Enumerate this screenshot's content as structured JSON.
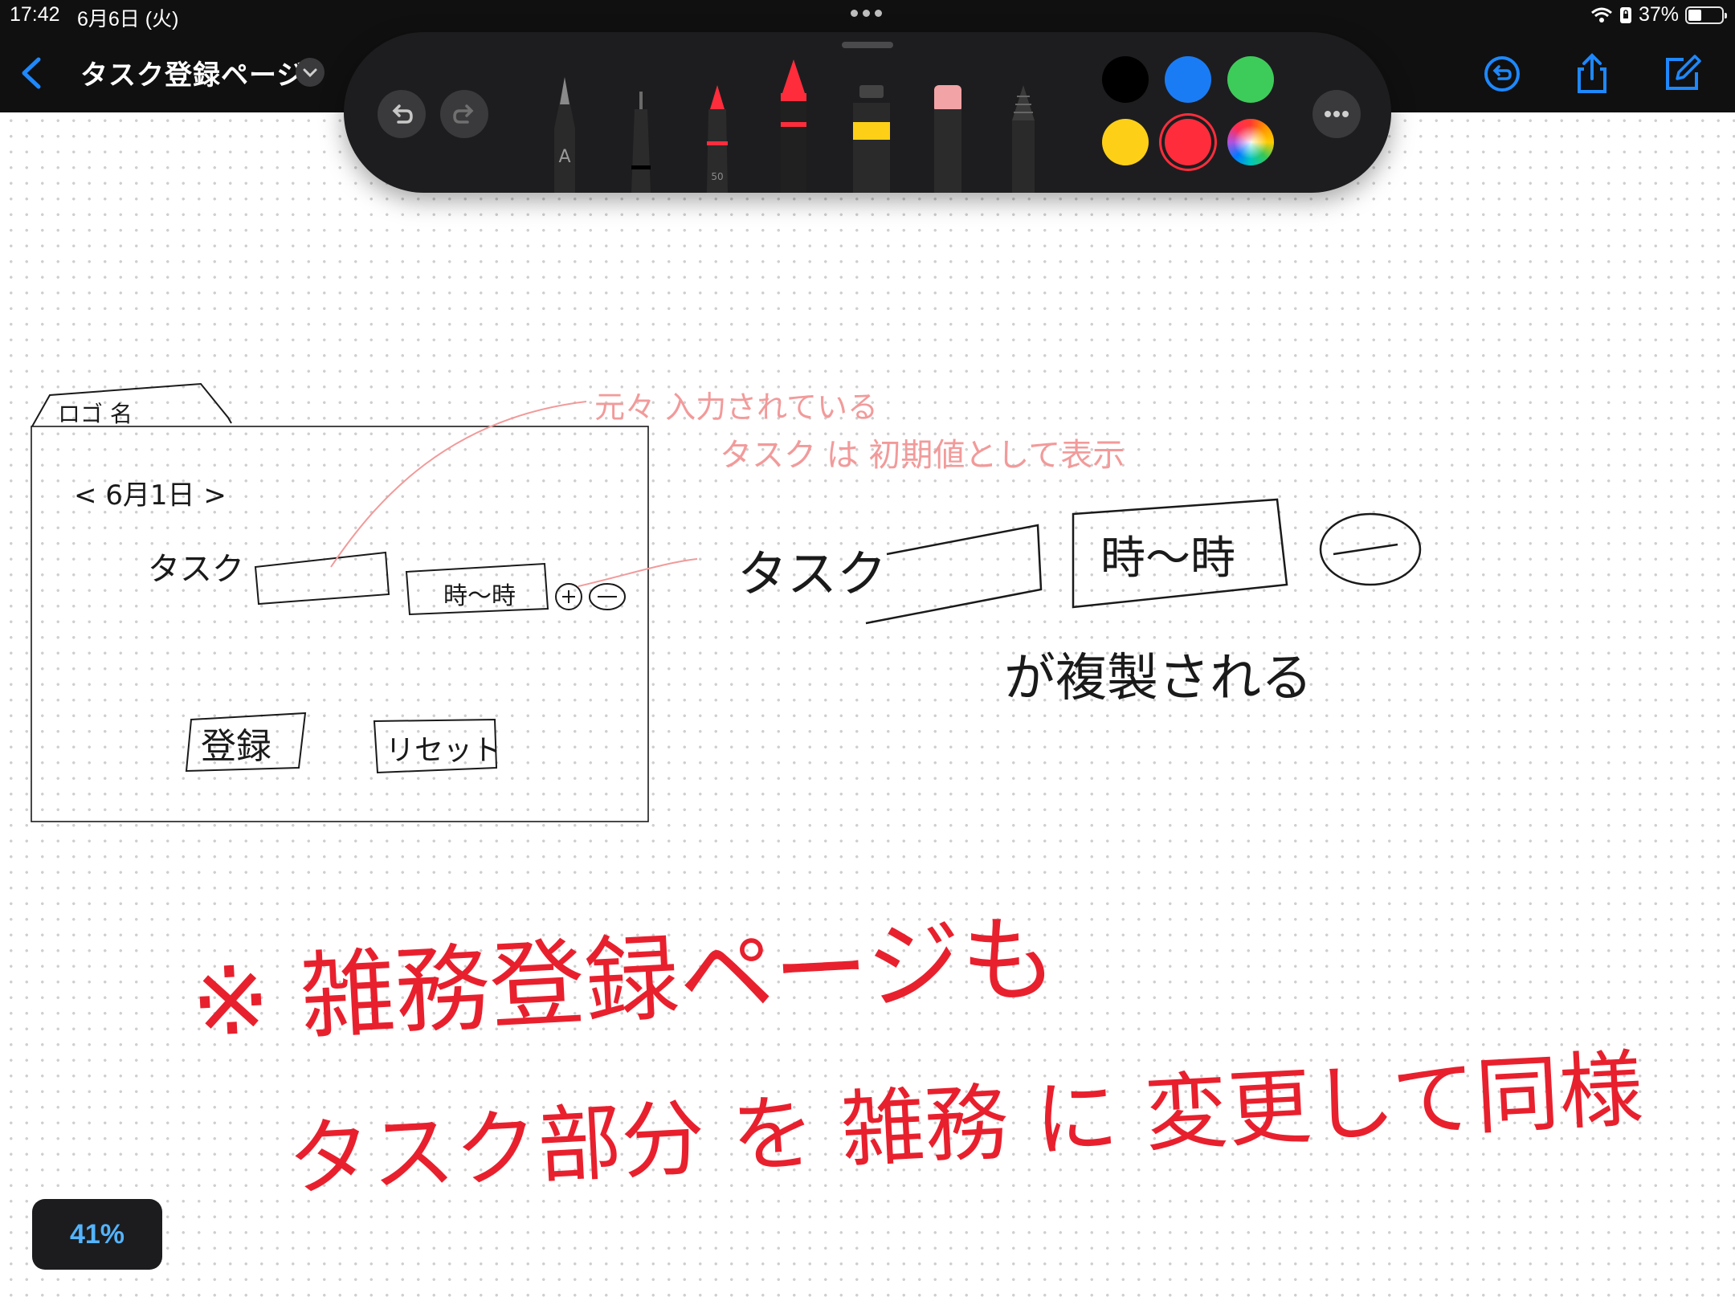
{
  "status_bar": {
    "time": "17:42",
    "date": "6月6日 (火)",
    "battery": "37%",
    "battery_level": 0.37
  },
  "nav": {
    "title": "タスク登録ページ"
  },
  "palette": {
    "pen_label": "A",
    "marker_size": "50",
    "colors": [
      "#000000",
      "#1a7cf5",
      "#3dcc5a",
      "#fdd017",
      "#ff2d3c"
    ],
    "selected_color": "#ff2d3c"
  },
  "zoom": {
    "level": "41%"
  },
  "drawing": {
    "stroke_colors": {
      "pencil": "#1a1a1a",
      "pink": "#f29a9a",
      "red": "#e8202d"
    },
    "logo_label": "ロゴ 名",
    "date_label": "< 6月1日 >",
    "task_label": "タスク",
    "time_label": "時〜時",
    "plus_minus": "⊕⊖",
    "register_button": "登録",
    "reset_button": "リセット",
    "note_pink_1": "元々 入力されている",
    "note_pink_2": "タスク は 初期値として表示",
    "big_task": "タスク",
    "big_time": "時〜時",
    "duplicate_note": "が複製される",
    "red_note_1": "※ 雑務登録ページも",
    "red_note_2": "タスク部分 を 雑務 に 変更して同様"
  }
}
